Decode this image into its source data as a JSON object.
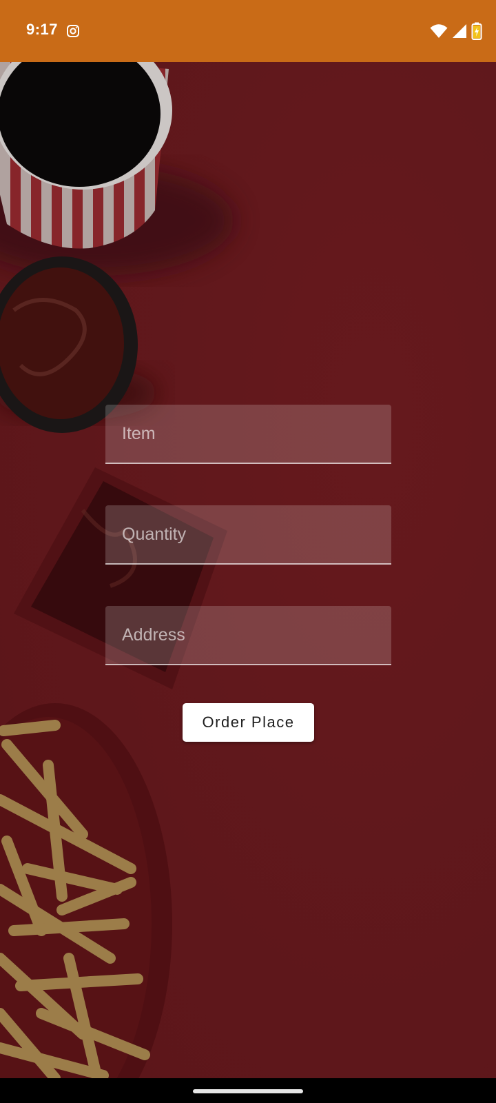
{
  "status_bar": {
    "time": "9:17",
    "left_icons": [
      "instagram-icon"
    ],
    "right_icons": [
      "wifi-icon",
      "cellular-signal-icon",
      "battery-charging-icon"
    ],
    "background_color": "#c96b17"
  },
  "form": {
    "item_placeholder": "Item",
    "quantity_placeholder": "Quantity",
    "address_placeholder": "Address",
    "submit_label": "Order Place"
  },
  "colors": {
    "background": "#6f1b1f",
    "button": "#ffffff"
  },
  "nav_bar": {
    "home_indicator": "home-gesture-pill"
  }
}
